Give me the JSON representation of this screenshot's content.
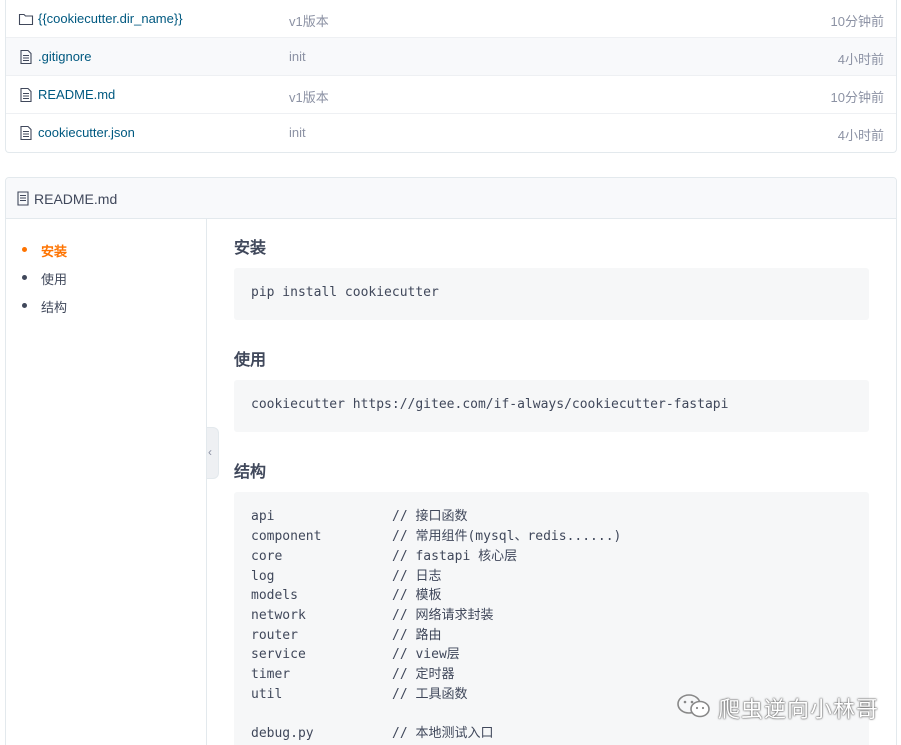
{
  "files": [
    {
      "icon": "folder-icon",
      "name": "{{cookiecutter.dir_name}}",
      "message": "v1版本",
      "time": "10分钟前"
    },
    {
      "icon": "file-icon",
      "name": ".gitignore",
      "message": "init",
      "time": "4小时前"
    },
    {
      "icon": "file-icon",
      "name": "README.md",
      "message": "v1版本",
      "time": "10分钟前"
    },
    {
      "icon": "file-icon",
      "name": "cookiecutter.json",
      "message": "init",
      "time": "4小时前"
    }
  ],
  "readme": {
    "title": "README.md",
    "icon": "readme-file-icon",
    "toc": [
      {
        "label": "安装",
        "active": true
      },
      {
        "label": "使用",
        "active": false
      },
      {
        "label": "结构",
        "active": false
      }
    ],
    "toggle_icon": "chevron-left-icon",
    "sections": {
      "install": {
        "heading": "安装",
        "code": [
          "pip install cookiecutter"
        ]
      },
      "usage": {
        "heading": "使用",
        "code": [
          "cookiecutter https://gitee.com/if-always/cookiecutter-fastapi"
        ]
      },
      "structure": {
        "heading": "结构",
        "rows": [
          {
            "name": "api",
            "comment": "// 接口函数"
          },
          {
            "name": "component",
            "comment": "// 常用组件(mysql、redis......)"
          },
          {
            "name": "core",
            "comment": "// fastapi 核心层"
          },
          {
            "name": "log",
            "comment": "// 日志"
          },
          {
            "name": "models",
            "comment": "// 模板"
          },
          {
            "name": "network",
            "comment": "// 网络请求封装"
          },
          {
            "name": "router",
            "comment": "// 路由"
          },
          {
            "name": "service",
            "comment": "// view层"
          },
          {
            "name": "timer",
            "comment": "// 定时器"
          },
          {
            "name": "util",
            "comment": "// 工具函数"
          },
          {
            "name": "",
            "comment": ""
          },
          {
            "name": "debug.py",
            "comment": "// 本地测试入口"
          }
        ]
      }
    }
  },
  "colors": {
    "link": "#005980",
    "accent": "#fe7300",
    "muted": "#8c92a4",
    "code_bg": "#f6f7f8"
  },
  "watermark": {
    "icon": "wechat-icon",
    "text": "爬虫逆向小林哥"
  }
}
